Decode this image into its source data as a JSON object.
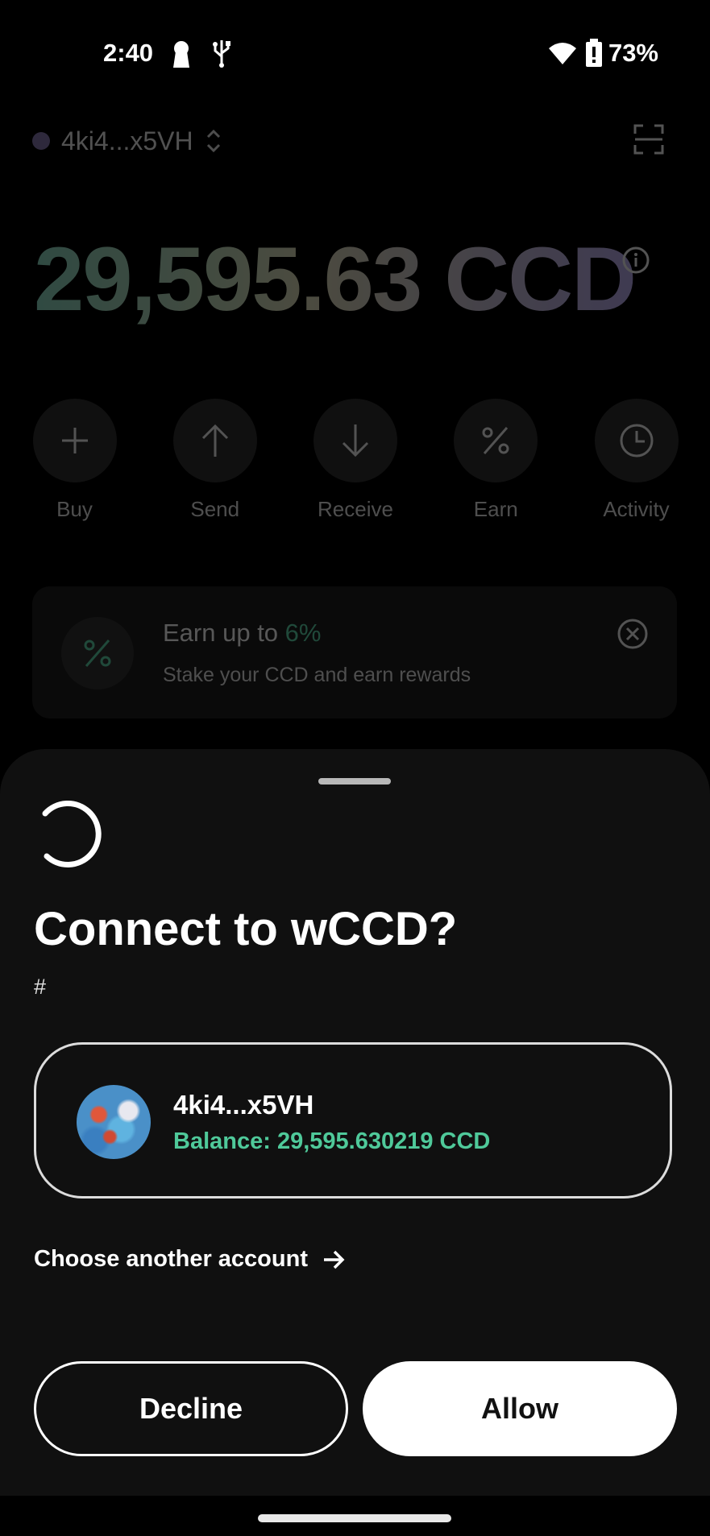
{
  "status_bar": {
    "time": "2:40",
    "battery": "73%",
    "icons": [
      "keyhole-icon",
      "usb-icon",
      "wifi-icon",
      "battery-icon"
    ]
  },
  "wallet": {
    "account_short": "4ki4...x5VH",
    "balance": "29,595.63 CCD",
    "actions": [
      {
        "label": "Buy",
        "icon": "plus-icon"
      },
      {
        "label": "Send",
        "icon": "arrow-up-icon"
      },
      {
        "label": "Receive",
        "icon": "arrow-down-icon"
      },
      {
        "label": "Earn",
        "icon": "percent-icon"
      },
      {
        "label": "Activity",
        "icon": "clock-icon"
      }
    ],
    "earn_banner": {
      "title_prefix": "Earn up to ",
      "title_pct": "6%",
      "subtitle": "Stake your CCD and earn rewards"
    }
  },
  "connect_sheet": {
    "title": "Connect to wCCD?",
    "url": "#",
    "account": {
      "name": "4ki4...x5VH",
      "balance": "Balance: 29,595.630219 CCD"
    },
    "choose_another": "Choose another account",
    "decline_label": "Decline",
    "allow_label": "Allow"
  },
  "colors": {
    "accent_green": "#4fc99a",
    "sheet_bg": "#101010"
  }
}
